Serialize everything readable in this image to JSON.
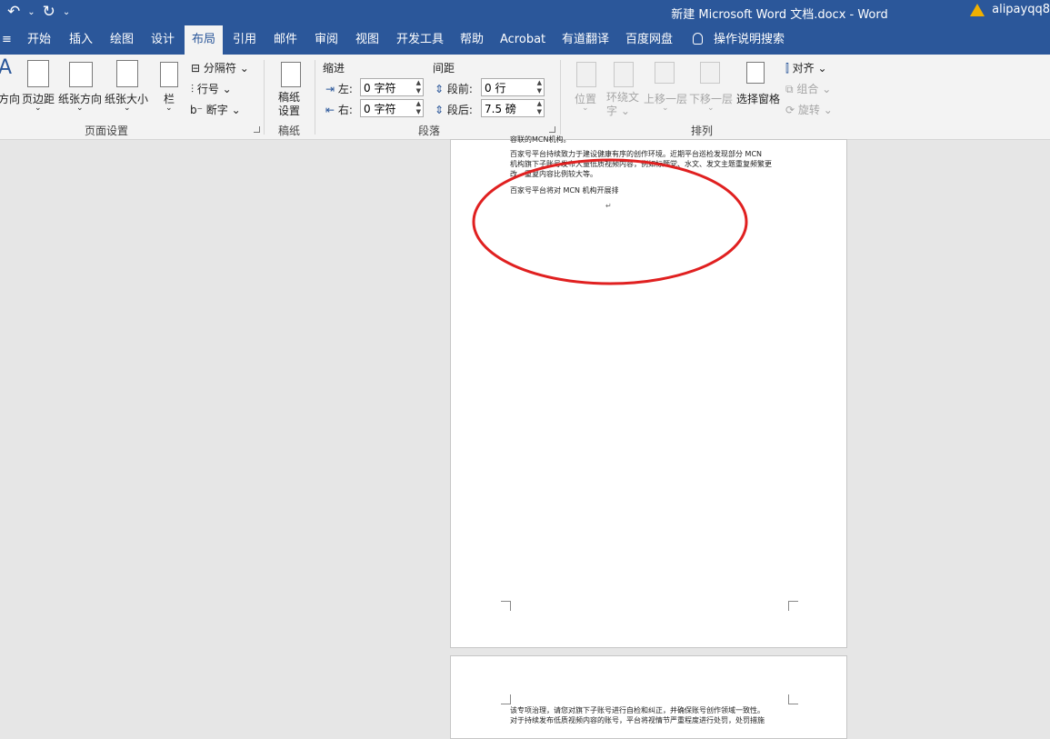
{
  "quick_access": {
    "undo_icon": "undo-icon",
    "redo_icon": "redo-icon",
    "customize_glyph": "⌄"
  },
  "title_bar": {
    "document_title": "新建 Microsoft Word 文档.docx  -  Word",
    "user_name": "alipayqq8"
  },
  "tabs": [
    "开始",
    "插入",
    "绘图",
    "设计",
    "布局",
    "引用",
    "邮件",
    "审阅",
    "视图",
    "开发工具",
    "帮助",
    "Acrobat",
    "有道翻译",
    "百度网盘",
    "操作说明搜索"
  ],
  "active_tab": "布局",
  "ribbon": {
    "page_setup": {
      "label": "页面设置",
      "buttons": {
        "direction": "方向",
        "margins": "页边距",
        "orientation": "纸张方向",
        "size": "纸张大小",
        "columns": "栏"
      },
      "breaks": "分隔符",
      "line_numbers": "行号",
      "hyphenation": "断字"
    },
    "manuscript": {
      "label": "稿纸",
      "button_line1": "稿纸",
      "button_line2": "设置"
    },
    "paragraph": {
      "label": "段落",
      "indent_header": "缩进",
      "spacing_header": "间距",
      "left_label": "左:",
      "left_value": "0 字符",
      "right_label": "右:",
      "right_value": "0 字符",
      "before_label": "段前:",
      "before_value": "0 行",
      "after_label": "段后:",
      "after_value": "7.5 磅"
    },
    "arrange": {
      "label": "排列",
      "position": "位置",
      "wrap_line1": "环绕文",
      "wrap_line2": "字",
      "bring_forward": "上移一层",
      "send_backward": "下移一层",
      "selection_pane": "选择窗格",
      "align": "对齐",
      "group": "组合",
      "rotate": "旋转"
    }
  },
  "page1": {
    "line_top": "容联的MCN机构。",
    "para1_l1": "百家号平台持续致力于建设健康有序的创作环境。近期平台巡检发现部分 MCN",
    "para1_l2": "机构旗下子账号发布大量低质视频内容，例如标题党、水文、发文主题重复频繁更",
    "para1_l3": "改，重复内容比例较大等。",
    "para2": "百家号平台将对 MCN 机构开展排",
    "empty_mark": "↵"
  },
  "page2": {
    "line1": "该专项治理，请您对旗下子账号进行自检和纠正，并确保账号创作领域一致性。",
    "line2": "对于持续发布低质视频内容的账号，平台将视情节严重程度进行处罚，处罚措施"
  },
  "colors": {
    "brand": "#2b579a",
    "annotation": "#e02020",
    "canvas": "#e6e6e6"
  }
}
